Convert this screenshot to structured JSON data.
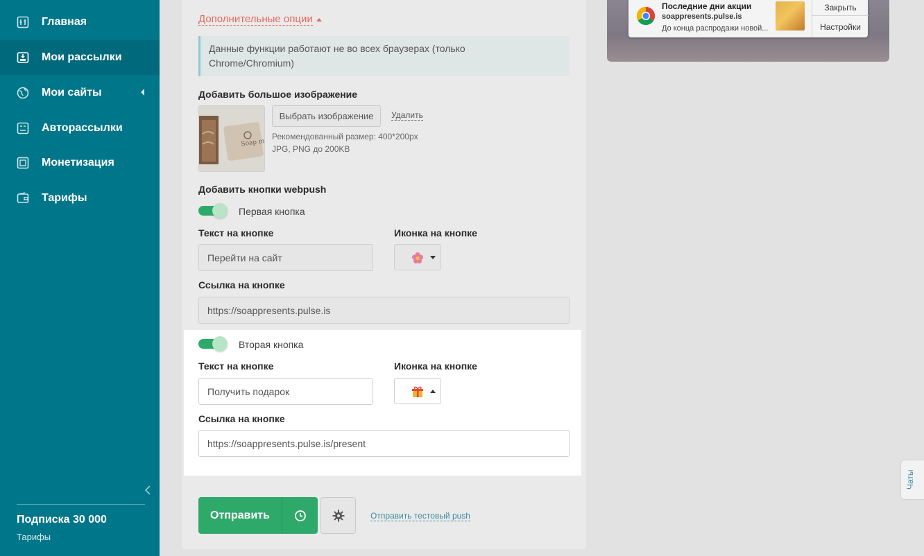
{
  "sidebar": {
    "items": [
      {
        "label": "Главная",
        "icon": "home-icon"
      },
      {
        "label": "Мои рассылки",
        "icon": "mailings-icon",
        "active": true
      },
      {
        "label": "Мои сайты",
        "icon": "globe-icon",
        "has_caret": true
      },
      {
        "label": "Авторассылки",
        "icon": "auto-mailing-icon"
      },
      {
        "label": "Монетизация",
        "icon": "monetization-icon"
      },
      {
        "label": "Тарифы",
        "icon": "wallet-icon"
      }
    ],
    "subscription": "Подписка 30 000",
    "tariffs_link": "Тарифы"
  },
  "form": {
    "extra_options": "Дополнительные опции",
    "info_line1": "Данные функции работают не во всех браузерах (только",
    "info_line2": "Chrome/Chromium)",
    "big_image_label": "Добавить большое изображение",
    "choose_image": "Выбрать изображение",
    "delete": "Удалить",
    "hint_size": "Рекомендованный размер: 400*200px",
    "hint_format": "JPG, PNG до 200KB",
    "webpush_buttons_label": "Добавить кнопки webpush",
    "button1": {
      "toggle_label": "Первая кнопка",
      "text_label": "Текст на кнопке",
      "text_value": "Перейти на сайт",
      "icon_label": "Иконка на кнопке",
      "icon": "flower-icon",
      "link_label": "Ссылка на кнопке",
      "link_value": "https://soappresents.pulse.is"
    },
    "button2": {
      "toggle_label": "Вторая кнопка",
      "text_label": "Текст на кнопке",
      "text_value": "Получить подарок",
      "icon_label": "Иконка на кнопке",
      "icon": "gift-icon",
      "link_label": "Ссылка на кнопке",
      "link_value": "https://soappresents.pulse.is/present"
    },
    "send": "Отправить",
    "test_push": "Отправить тестовый push"
  },
  "preview": {
    "title": "Последние дни акции",
    "site": "soappresents.pulse.is",
    "text": "До конца распродажи новой...",
    "close": "Закрыть",
    "settings": "Настройки"
  },
  "chats": "Чаты",
  "colors": {
    "sidebar": "#00768a",
    "accent_green": "#2fa96a",
    "link_red": "#e4685c"
  }
}
